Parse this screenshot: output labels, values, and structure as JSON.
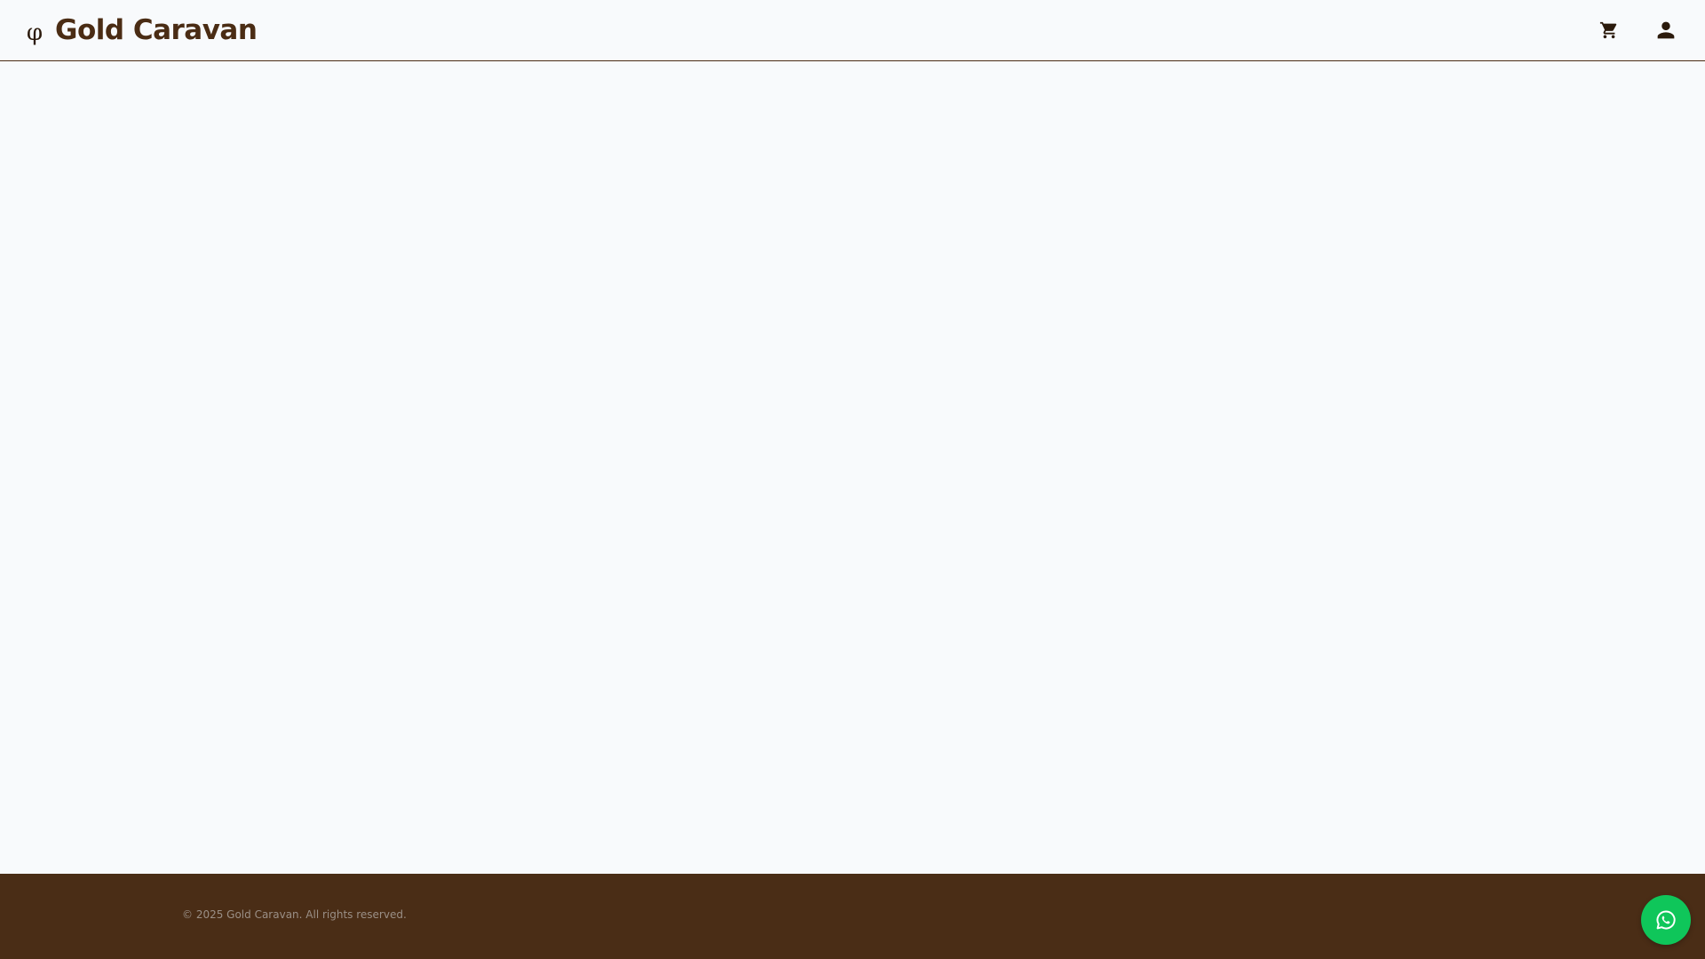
{
  "header": {
    "logo_glyph": "φ",
    "brand_name": "Gold Caravan",
    "actions": {
      "cart_icon": "cart-icon",
      "account_icon": "person-icon"
    }
  },
  "footer": {
    "copyright": "© 2025 Gold Caravan. All rights reserved."
  },
  "floating": {
    "whatsapp_icon": "whatsapp-icon"
  },
  "colors": {
    "brand_brown": "#4a2c14",
    "footer_bg": "#4a2d16",
    "page_bg": "#f8fafc",
    "whatsapp_green": "#0fc65a"
  }
}
